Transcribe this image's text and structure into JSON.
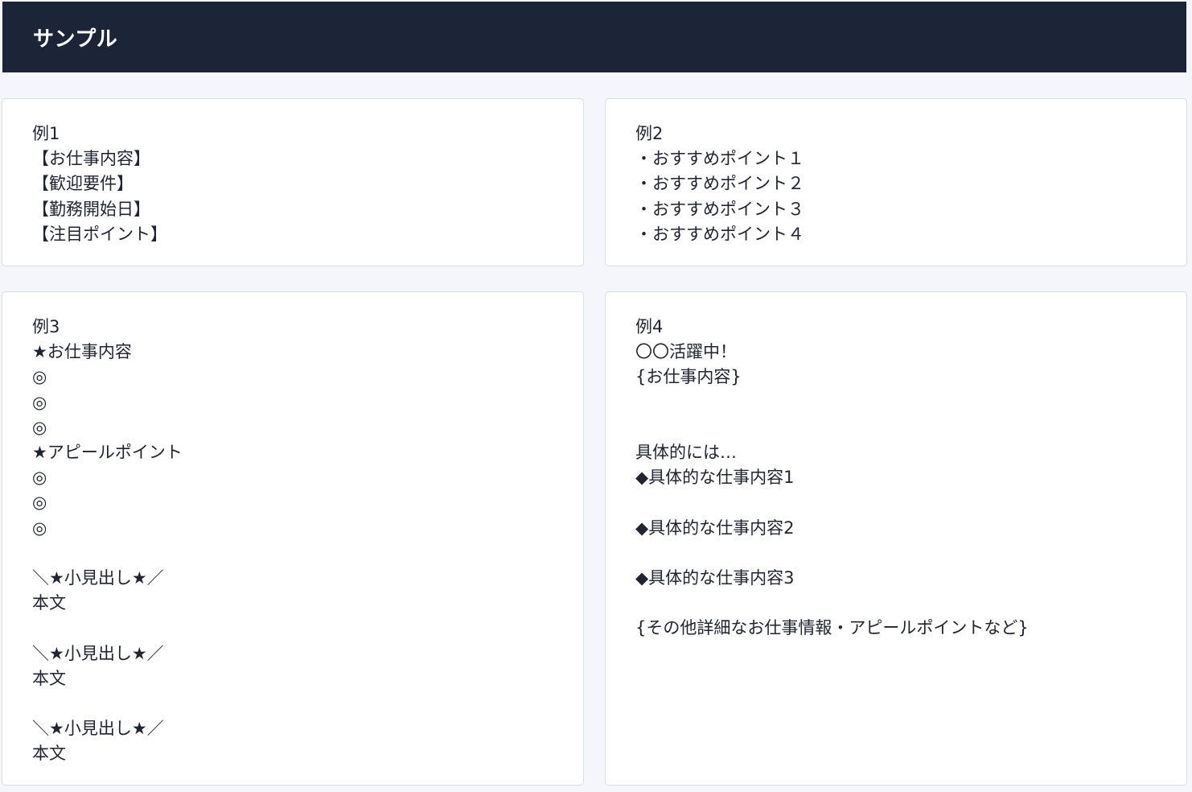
{
  "header": {
    "title": "サンプル"
  },
  "cards": [
    {
      "text": "例1\n【お仕事内容】\n【歓迎要件】\n【勤務開始日】\n【注目ポイント】"
    },
    {
      "text": "例2\n・おすすめポイント１\n・おすすめポイント２\n・おすすめポイント３\n・おすすめポイント４"
    },
    {
      "text": "例3\n★お仕事内容\n◎\n◎\n◎\n★アピールポイント\n◎\n◎\n◎\n\n＼★小見出し★／\n本文\n\n＼★小見出し★／\n本文\n\n＼★小見出し★／\n本文"
    },
    {
      "text": "例4\n〇〇活躍中！\n{お仕事内容}\n\n\n具体的には…\n◆具体的な仕事内容1\n\n◆具体的な仕事内容2\n\n◆具体的な仕事内容3\n\n{その他詳細なお仕事情報・アピールポイントなど}"
    }
  ],
  "colors": {
    "header_background": "#1b2537",
    "page_background": "#f5f6fb",
    "card_border": "#d9dce3",
    "text": "#1f2430"
  }
}
